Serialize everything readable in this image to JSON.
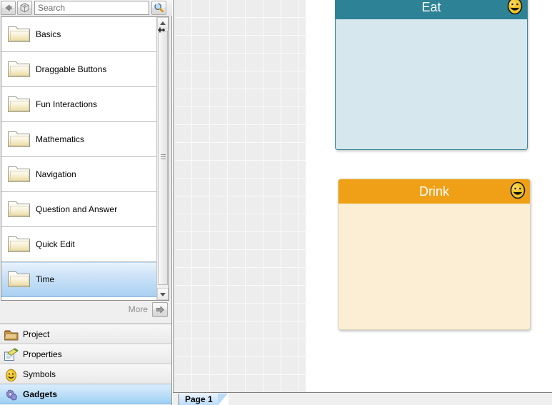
{
  "toolbar": {
    "back_icon": "back-arrow-icon",
    "home_icon": "package-home-icon",
    "search_go_icon": "magnifier-icon"
  },
  "search": {
    "value": "",
    "placeholder": "Search"
  },
  "library": {
    "items": [
      {
        "label": "Basics",
        "icon": "folder-icon",
        "selected": false
      },
      {
        "label": "Draggable Buttons",
        "icon": "folder-icon",
        "selected": false
      },
      {
        "label": "Fun Interactions",
        "icon": "folder-icon",
        "selected": false
      },
      {
        "label": "Mathematics",
        "icon": "folder-icon",
        "selected": false
      },
      {
        "label": "Navigation",
        "icon": "folder-icon",
        "selected": false
      },
      {
        "label": "Question and Answer",
        "icon": "folder-icon",
        "selected": false
      },
      {
        "label": "Quick Edit",
        "icon": "folder-icon",
        "selected": false
      },
      {
        "label": "Time",
        "icon": "folder-icon",
        "selected": true
      }
    ],
    "more_label": "More",
    "more_icon": "right-arrow-icon",
    "scrollbar": {
      "up_icon": "scroll-up-arrow-icon",
      "down_icon": "scroll-down-arrow-icon"
    }
  },
  "dock": {
    "pin_icon": "auto-hide-pin-icon",
    "items": [
      {
        "label": "Project",
        "icon": "project-folder-icon",
        "active": false
      },
      {
        "label": "Properties",
        "icon": "properties-pad-icon",
        "active": false
      },
      {
        "label": "Symbols",
        "icon": "smiley-symbol-icon",
        "active": false
      },
      {
        "label": "Gadgets",
        "icon": "gears-icon",
        "active": true
      }
    ]
  },
  "canvas": {
    "cards": [
      {
        "title": "Eat",
        "smiley_icon": "smiley-face-icon",
        "header_color": "#2e8296",
        "body_color": "#d6e7ee",
        "border_color": "#2e8296"
      },
      {
        "title": "Drink",
        "smiley_icon": "smiley-face-icon",
        "header_color": "#f0a017",
        "body_color": "#fbeed4",
        "border_color": "#d9d3bb"
      }
    ]
  },
  "tabbar": {
    "page_tab_label": "Page 1"
  }
}
